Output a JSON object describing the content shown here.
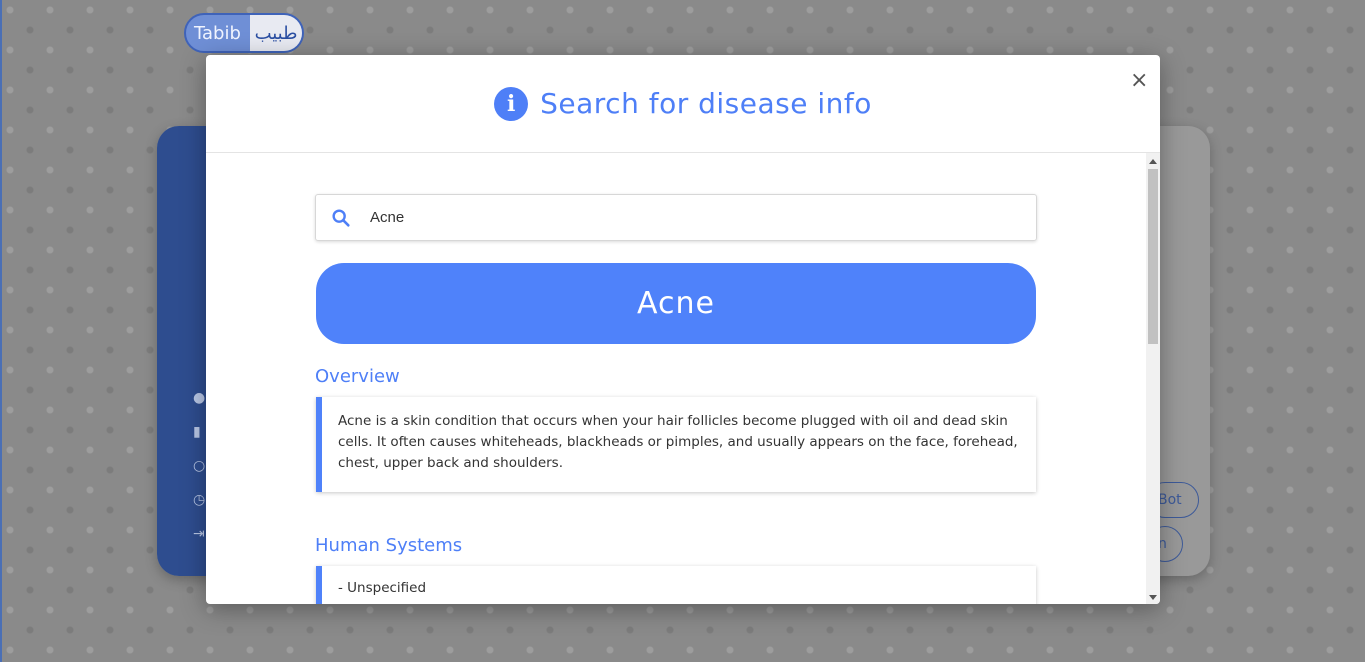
{
  "app": {
    "logo_en": "Tabib",
    "logo_ar": "طبيب"
  },
  "background": {
    "button_bot_label": "Bot",
    "button_second_label": "n"
  },
  "modal": {
    "title": "Search for disease info",
    "close_label": "×",
    "search": {
      "value": "Acne",
      "placeholder": ""
    },
    "disease_name": "Acne",
    "sections": [
      {
        "title": "Overview",
        "content": "Acne is a skin condition that occurs when your hair follicles become plugged with oil and dead skin cells. It often causes whiteheads, blackheads or pimples, and usually appears on the face, forehead, chest, upper back and shoulders."
      },
      {
        "title": "Human Systems",
        "content": "- Unspecified"
      }
    ]
  },
  "colors": {
    "accent": "#4e7ff7",
    "banner": "#4f82fa",
    "sidebar_dim": "#2e4d8f"
  },
  "icons": {
    "info": "info-icon",
    "search": "search-icon",
    "close": "close-icon"
  }
}
